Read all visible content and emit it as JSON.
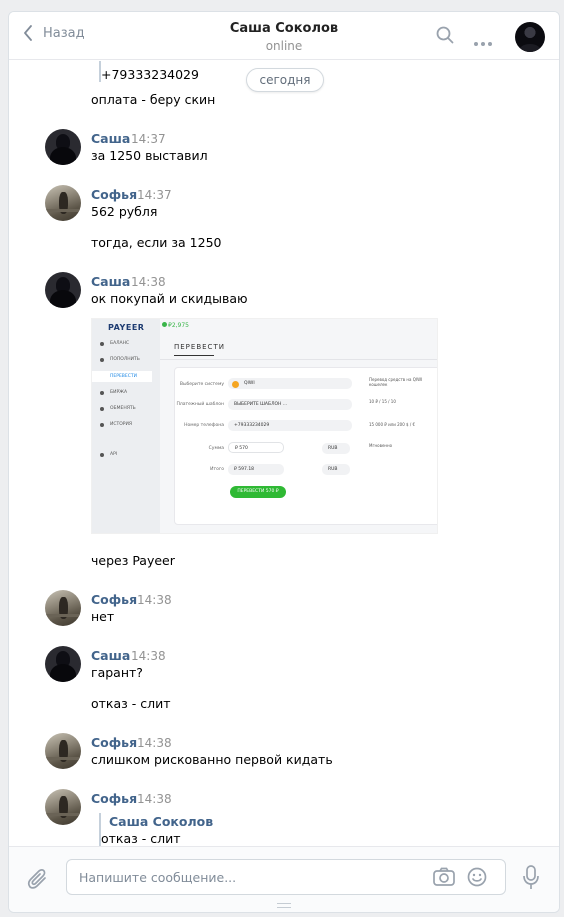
{
  "header": {
    "back_label": "Назад",
    "title": "Саша Соколов",
    "status": "online"
  },
  "date_separator": "сегодня",
  "top_fragment": {
    "quoted_phone": "+79333234029",
    "text": "оплата - беру скин"
  },
  "messages": [
    {
      "author": "Саша",
      "time": "14:37",
      "lines": [
        "за 1250 выставил"
      ]
    },
    {
      "author": "Софья",
      "time": "14:37",
      "lines": [
        "562 рубля",
        "тогда, если за 1250"
      ]
    },
    {
      "author": "Саша",
      "time": "14:38",
      "lines": [
        "ок покупай и скидываю",
        "через Payeer"
      ]
    },
    {
      "author": "Софья",
      "time": "14:38",
      "lines": [
        "нет"
      ]
    },
    {
      "author": "Саша",
      "time": "14:38",
      "lines": [
        "гарант?",
        "отказ - слит"
      ]
    },
    {
      "author": "Софья",
      "time": "14:38",
      "lines": [
        "слишком рискованно первой кидать"
      ]
    },
    {
      "author": "Софья",
      "time": "14:38",
      "quote_author": "Саша Соколов",
      "quote_text": "отказ - слит"
    }
  ],
  "attachment": {
    "logo": "PAYEER",
    "balance": "₽2,975",
    "menu": [
      "БАЛАНС",
      "ПОПОЛНИТЬ",
      "ПЕРЕВЕСТИ",
      "БИРЖА",
      "ОБМЕНЯТЬ",
      "ИСТОРИЯ",
      "API"
    ],
    "page_title": "ПЕРЕВЕСТИ",
    "labels": [
      "Выберите систему",
      "Платежный шаблон",
      "Номер телефона",
      "Сумма",
      "Итого"
    ],
    "system_value": "QIWI",
    "template_value": "ВЫБЕРИТЕ ШАБЛОН ...",
    "phone_value": "+79333234029",
    "amount_value": "₽ 570",
    "total_value": "₽ 597.18",
    "currency": "RUB",
    "submit_label": "ПЕРЕВЕСТИ 570 ₽",
    "right_info": [
      "Перевод средств на QIWI кошелек",
      "10 ₽ / 15 / 10",
      "15 000 ₽ или 200 $ / €",
      "Мгновенно"
    ]
  },
  "composer": {
    "placeholder": "Напишите сообщение..."
  }
}
